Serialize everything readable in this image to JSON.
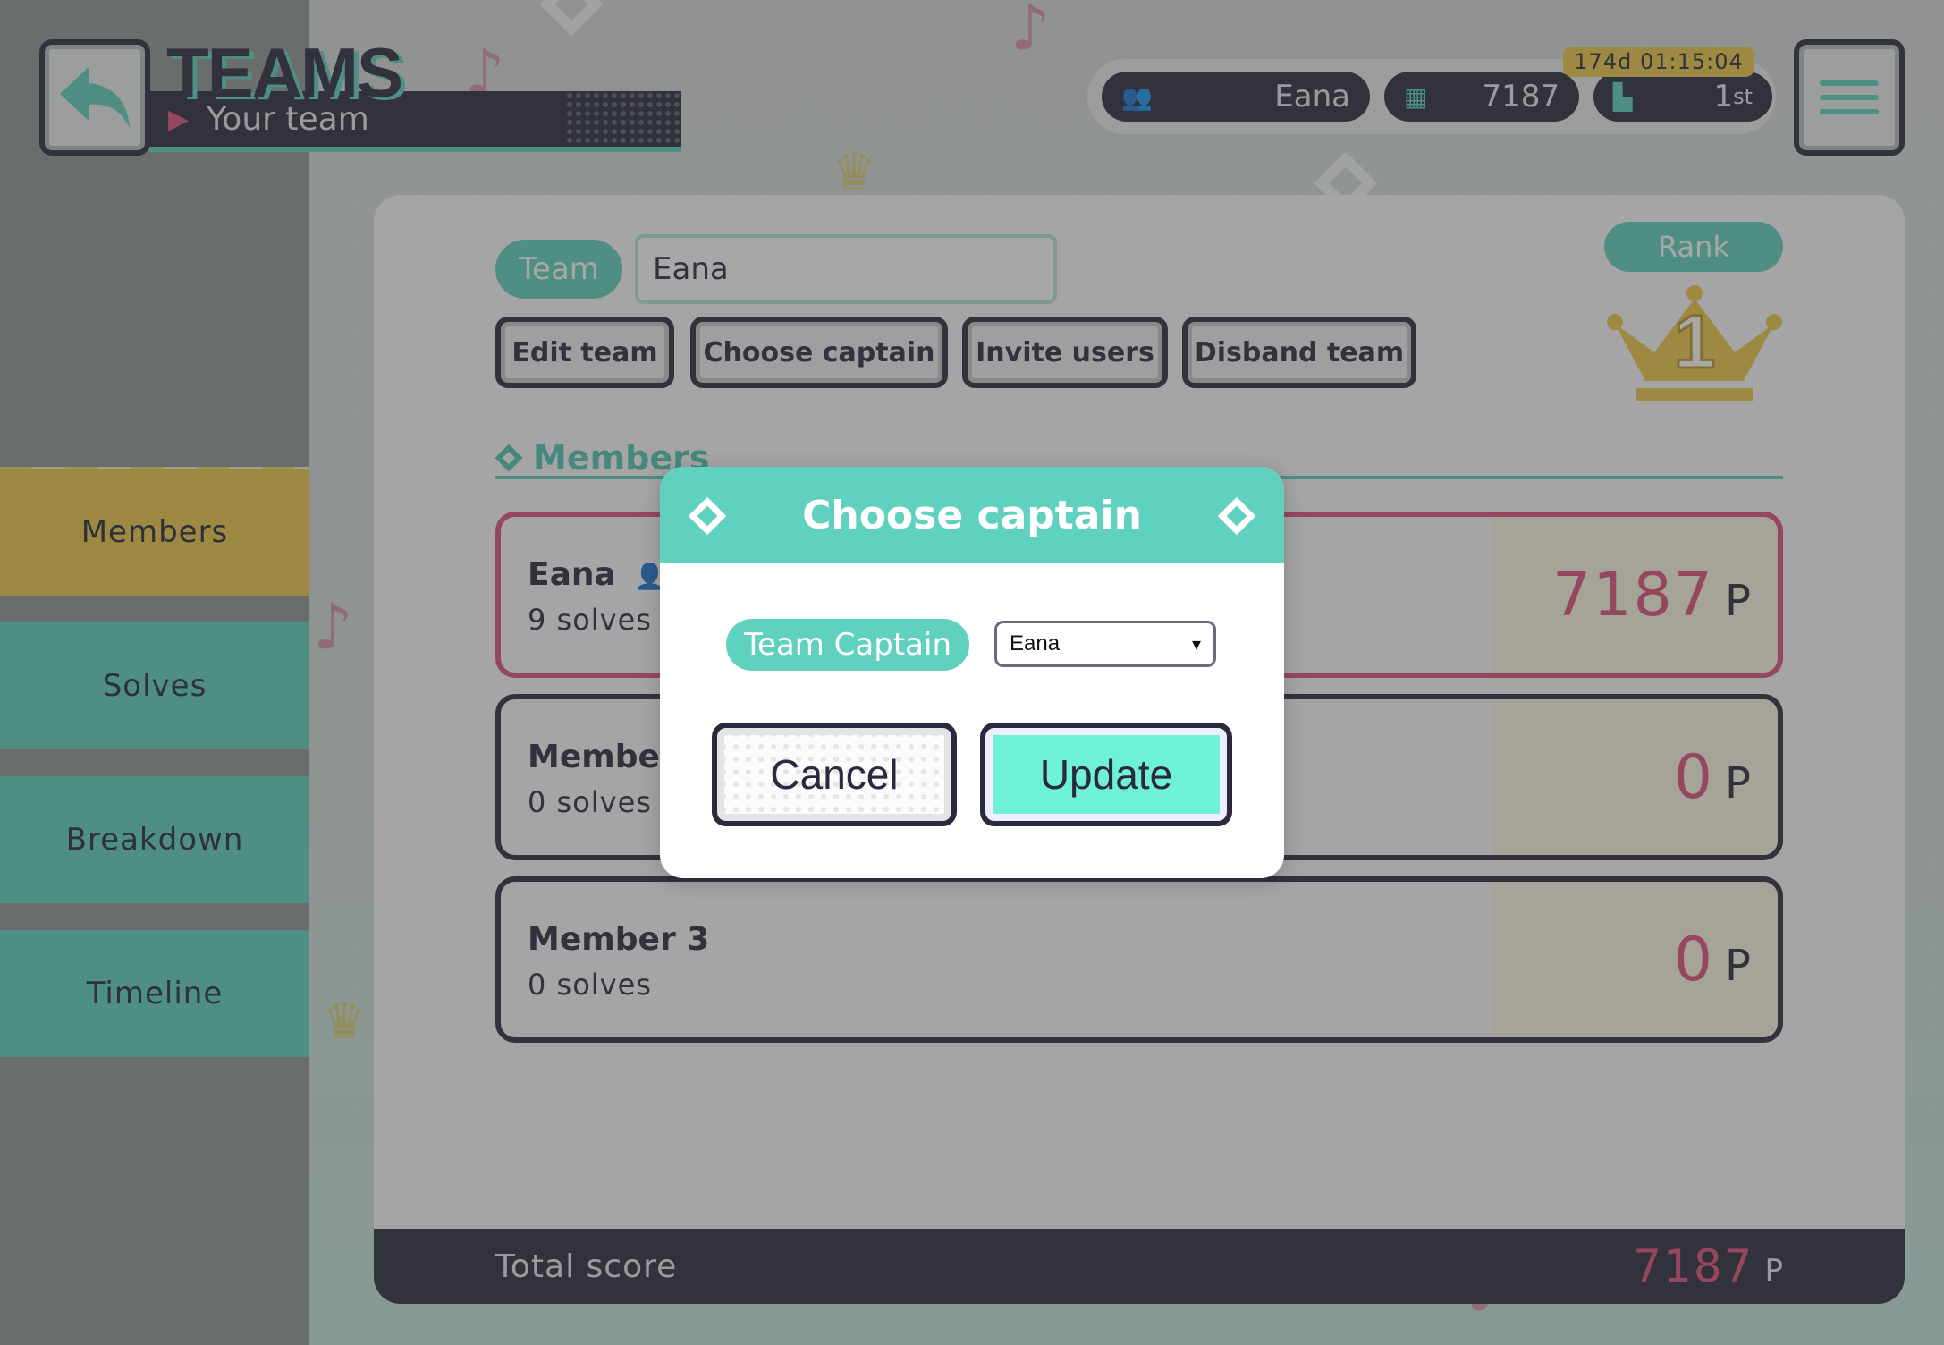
{
  "header": {
    "title": "TEAMS",
    "subtitle": "Your team",
    "username": "Eana",
    "score": "7187",
    "rank": "1",
    "rank_suffix": "st",
    "timer": "174d 01:15:04"
  },
  "sidebar": {
    "items": [
      {
        "label": "Members",
        "active": true
      },
      {
        "label": "Solves",
        "active": false
      },
      {
        "label": "Breakdown",
        "active": false
      },
      {
        "label": "Timeline",
        "active": false
      }
    ]
  },
  "team": {
    "tag": "Team",
    "name": "Eana",
    "actions": {
      "edit": "Edit team",
      "captain": "Choose captain",
      "invite": "Invite users",
      "disband": "Disband team"
    },
    "rank_label": "Rank",
    "rank_value": "1",
    "members_heading": "Members",
    "members": [
      {
        "name": "Eana",
        "solves": "9 solves",
        "score": "7187",
        "unit": "P",
        "captain": true
      },
      {
        "name": "Member",
        "solves": "0 solves",
        "score": "0",
        "unit": "P",
        "captain": false
      },
      {
        "name": "Member 3",
        "solves": "0 solves",
        "score": "0",
        "unit": "P",
        "captain": false
      }
    ],
    "total_label": "Total score",
    "total_value": "7187",
    "total_unit": "P"
  },
  "modal": {
    "title": "Choose captain",
    "field_label": "Team Captain",
    "selected": "Eana",
    "cancel": "Cancel",
    "update": "Update"
  },
  "colors": {
    "accent": "#5fd1be",
    "dark": "#2a2a3e",
    "pink": "#e0507e",
    "gold": "#efc94a"
  }
}
